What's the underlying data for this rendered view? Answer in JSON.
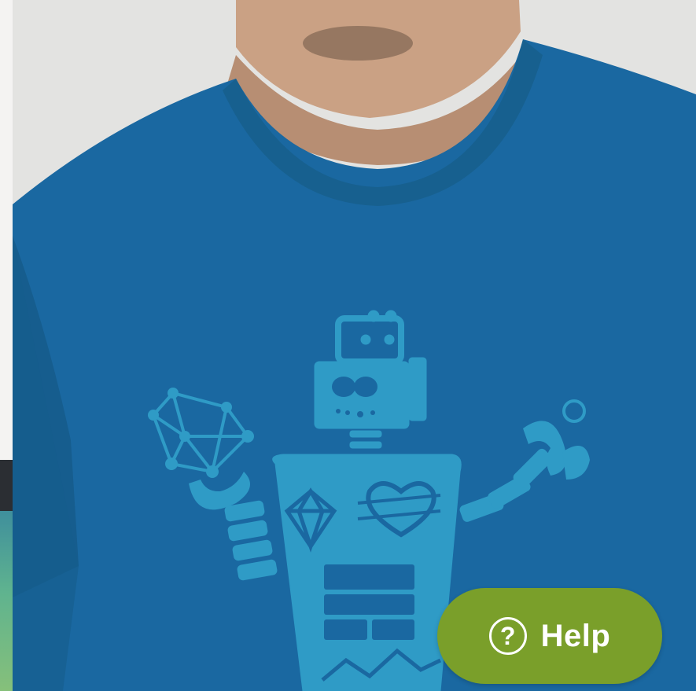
{
  "help_button": {
    "label": "Help",
    "icon": "question-circle-icon",
    "color": "#7a9f2a"
  },
  "photo": {
    "shirt_color": "#1a68a1",
    "print_color": "#2f9bc6"
  }
}
